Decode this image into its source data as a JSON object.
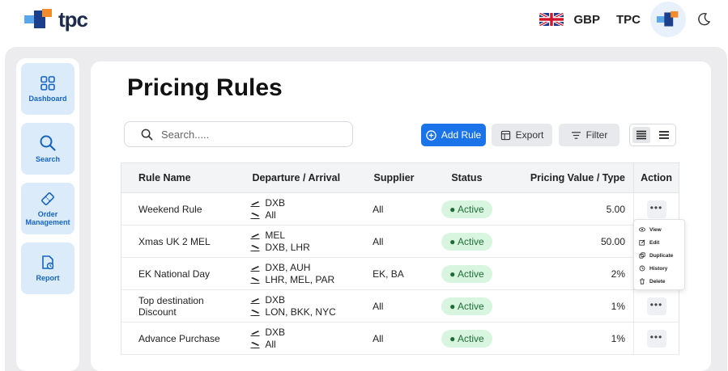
{
  "brand": {
    "name": "tpc"
  },
  "header": {
    "currency": "GBP",
    "org": "TPC"
  },
  "sidebar": {
    "items": [
      {
        "label": "Dashboard",
        "icon": "grid-icon"
      },
      {
        "label": "Search",
        "icon": "search-icon"
      },
      {
        "label": "Order Management",
        "icon": "ticket-icon"
      },
      {
        "label": "Report",
        "icon": "report-icon"
      }
    ]
  },
  "page": {
    "title": "Pricing Rules"
  },
  "search": {
    "placeholder": "Search....."
  },
  "toolbar": {
    "add_label": "Add Rule",
    "export_label": "Export",
    "filter_label": "Filter"
  },
  "table": {
    "headers": {
      "name": "Rule Name",
      "route": "Departure / Arrival",
      "supplier": "Supplier",
      "status": "Status",
      "value": "Pricing Value / Type",
      "action": "Action"
    },
    "rows": [
      {
        "name": "Weekend Rule",
        "departure": "DXB",
        "arrival": "All",
        "supplier": "All",
        "status": "Active",
        "value": "5.00"
      },
      {
        "name": "Xmas UK 2 MEL",
        "departure": "MEL",
        "arrival": "DXB, LHR",
        "supplier": "All",
        "status": "Active",
        "value": "50.00"
      },
      {
        "name": "EK National Day",
        "departure": "DXB, AUH",
        "arrival": "LHR,  MEL, PAR",
        "supplier": "EK, BA",
        "status": "Active",
        "value": "2%"
      },
      {
        "name": "Top destination Discount",
        "departure": "DXB",
        "arrival": "LON, BKK, NYC",
        "supplier": "All",
        "status": "Active",
        "value": "1%"
      },
      {
        "name": "Advance Purchase",
        "departure": "DXB",
        "arrival": "All",
        "supplier": "All",
        "status": "Active",
        "value": "1%"
      }
    ]
  },
  "action_menu": {
    "items": [
      "View",
      "Edit",
      "Duplicate",
      "History",
      "Delete"
    ]
  },
  "colors": {
    "primary": "#1a73e8",
    "active_bg": "#d8f5df",
    "active_text": "#1e6d35",
    "sidebar_bg": "#dcebfa"
  }
}
